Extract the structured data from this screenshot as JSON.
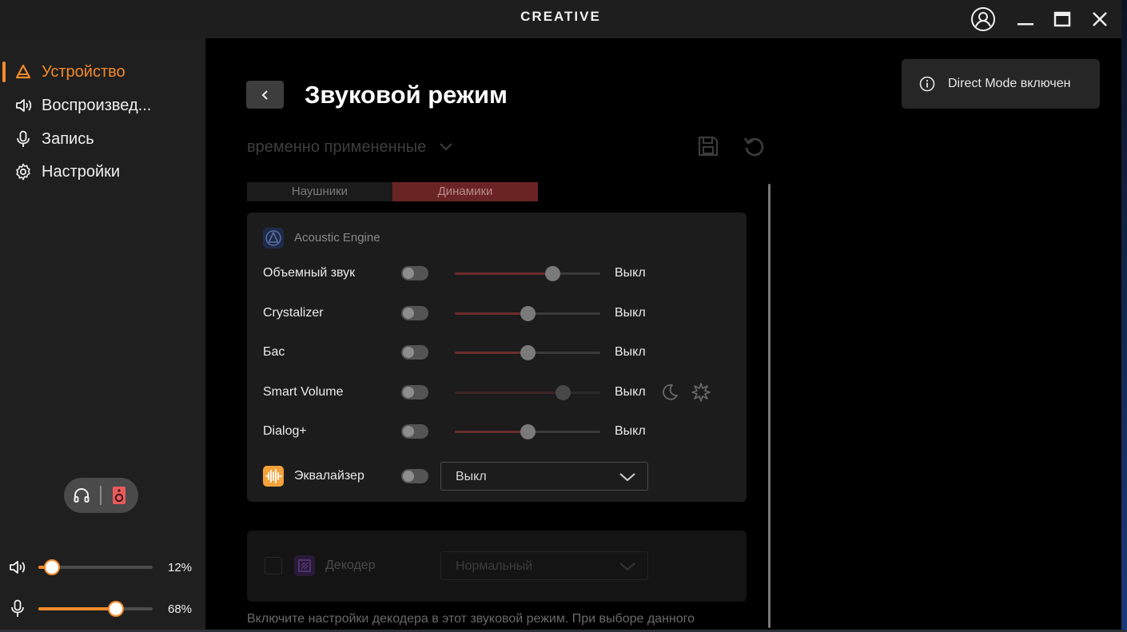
{
  "app": {
    "logo": "CREATIVE"
  },
  "sidebar": {
    "items": [
      {
        "label": "Устройство",
        "icon": "creative-device-icon",
        "active": true
      },
      {
        "label": "Воспроизвед...",
        "icon": "speaker-icon",
        "active": false
      },
      {
        "label": "Запись",
        "icon": "microphone-icon",
        "active": false
      },
      {
        "label": "Настройки",
        "icon": "gear-icon",
        "active": false
      }
    ],
    "output_switch": {
      "options": [
        "headphones-icon",
        "speaker-box-icon"
      ],
      "selected": "speaker-box-icon"
    },
    "volume": {
      "playback_percent": "12%",
      "playback_value": 12,
      "record_percent": "68%",
      "record_value": 68
    }
  },
  "main": {
    "title": "Звуковой режим",
    "preset": "временно примененные",
    "tabs": [
      {
        "label": "Наушники",
        "active": false
      },
      {
        "label": "Динамики",
        "active": true
      }
    ],
    "engine_title": "Acoustic Engine",
    "settings": [
      {
        "label": "Объемный звук",
        "value": "Выкл",
        "slider": 67,
        "enabled": true
      },
      {
        "label": "Crystalizer",
        "value": "Выкл",
        "slider": 50,
        "enabled": true
      },
      {
        "label": "Бас",
        "value": "Выкл",
        "slider": 50,
        "enabled": true
      },
      {
        "label": "Smart Volume",
        "value": "Выкл",
        "slider": 74,
        "enabled": false
      },
      {
        "label": "Dialog+",
        "value": "Выкл",
        "slider": 50,
        "enabled": true
      }
    ],
    "equalizer": {
      "label": "Эквалайзер",
      "value": "Выкл"
    },
    "decoder": {
      "label": "Декодер",
      "value": "Нормальный"
    },
    "footnote": "Включите настройки декодера в этот звуковой режим. При выборе данного"
  },
  "toast": {
    "text": "Direct Mode включен"
  },
  "colors": {
    "accent": "#f28a2c",
    "active_tab": "#6b2424",
    "panel": "#1c1c1c",
    "sidebar": "#1f1f1f"
  }
}
